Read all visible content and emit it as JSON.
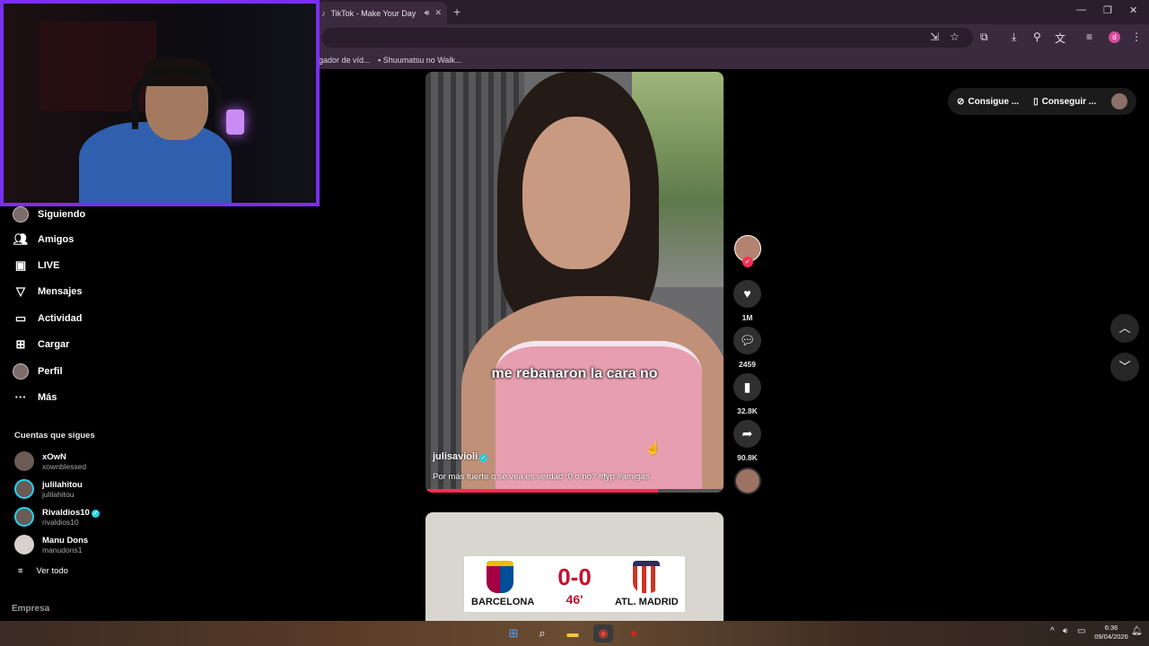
{
  "browser": {
    "tab_title": "TikTok - Make Your Day",
    "new_tab": "+",
    "bookmarks": [
      "gador de víd...",
      "Shuumatsu no Walk..."
    ],
    "profile_initial": "d"
  },
  "sidebar": {
    "items": [
      {
        "label": "Siguiendo",
        "icon": "avatar-icon"
      },
      {
        "label": "Amigos",
        "icon": "friends-icon"
      },
      {
        "label": "LIVE",
        "icon": "live-icon"
      },
      {
        "label": "Mensajes",
        "icon": "messages-icon"
      },
      {
        "label": "Actividad",
        "icon": "activity-icon"
      },
      {
        "label": "Cargar",
        "icon": "upload-icon"
      },
      {
        "label": "Perfil",
        "icon": "profile-icon"
      },
      {
        "label": "Más",
        "icon": "more-icon"
      }
    ],
    "following_title": "Cuentas que sigues",
    "following": [
      {
        "name": "xOwN",
        "handle": "xownblessed",
        "verified": false
      },
      {
        "name": "julilahitou",
        "handle": "julilahitou",
        "verified": false
      },
      {
        "name": "Rivaldios10",
        "handle": "rivaldios10",
        "verified": true
      },
      {
        "name": "Manu Dons",
        "handle": "manudons1",
        "verified": false
      }
    ],
    "see_all": "Ver todo",
    "company": "Empresa"
  },
  "video": {
    "caption_overlay": "me rebanaron la cara no",
    "username": "julisavioli",
    "description": "Por más fuerte q se vea es verdad :0 o no? #fyp #amigas",
    "progress": 0.78,
    "likes": "1M",
    "comments": "2459",
    "saves": "32.8K",
    "shares": "90.8K"
  },
  "next_video": {
    "home_team": "BARCELONA",
    "away_team": "ATL. MADRID",
    "score": "0-0",
    "minute": "46'"
  },
  "topbar": {
    "btn1": "Consigue ...",
    "btn2": "Conseguir ..."
  },
  "taskbar": {
    "time": "6:36",
    "date": "09/04/2026"
  },
  "colors": {
    "accent": "#fe2c55",
    "webcam_border": "#7b2ff0",
    "verified": "#20d5ec"
  }
}
